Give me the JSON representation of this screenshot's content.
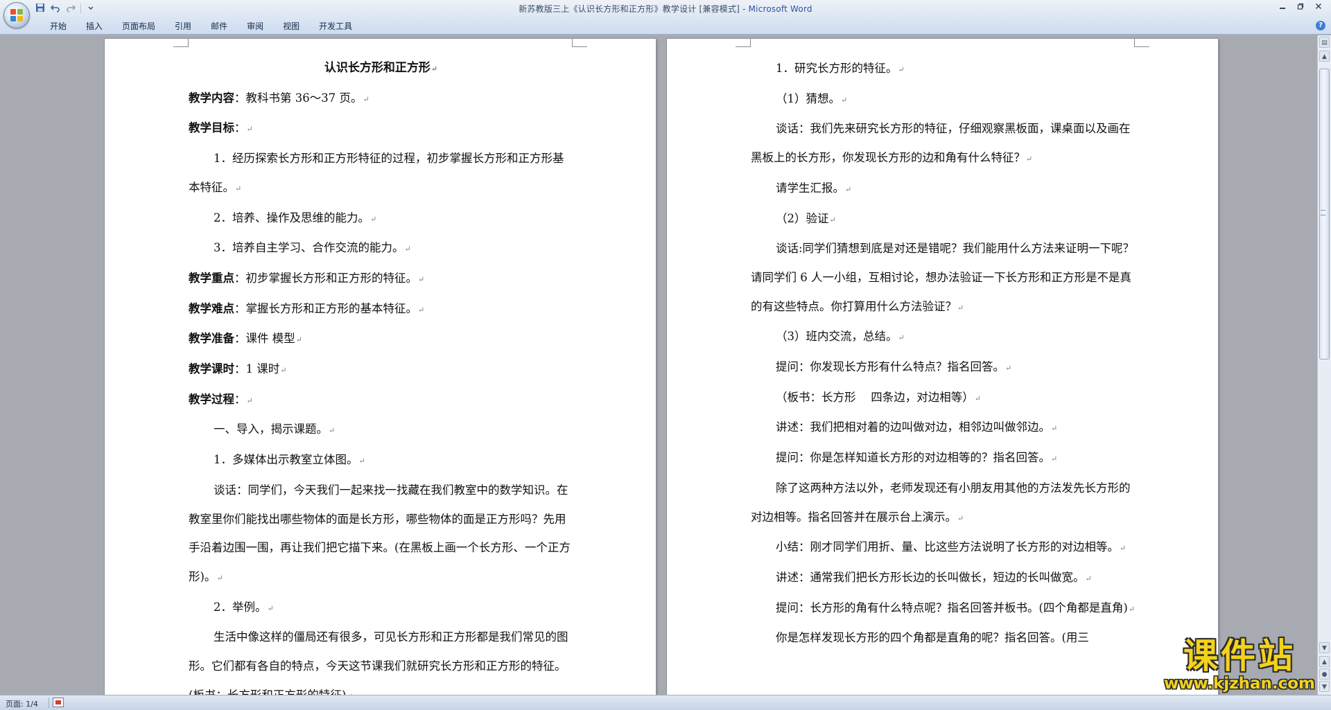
{
  "window": {
    "title": "新苏教版三上《认识长方形和正方形》教学设计 [兼容模式] - ",
    "app_name": "Microsoft Word"
  },
  "ribbon": {
    "tabs": [
      {
        "label": "开始"
      },
      {
        "label": "插入"
      },
      {
        "label": "页面布局"
      },
      {
        "label": "引用"
      },
      {
        "label": "邮件"
      },
      {
        "label": "审阅"
      },
      {
        "label": "视图"
      },
      {
        "label": "开发工具"
      }
    ]
  },
  "icons": {
    "office_button": "office-logo-icon",
    "save": "save-icon",
    "undo": "undo-icon",
    "redo": "redo-icon",
    "customize": "chevron-down-icon",
    "minimize": "minimize-icon",
    "restore": "restore-icon",
    "close": "close-icon",
    "help": "help-icon"
  },
  "colors": {
    "ribbon_bg": "#dce7f5",
    "page_bg": "#ffffff",
    "workspace_bg": "#a7abb1",
    "watermark_text": "#f3d21c"
  },
  "page_left": {
    "title": "认识长方形和正方形",
    "p1_label": "教学内容",
    "p1_text": "：教科书第 36～37 页。",
    "p2_label": "教学目标",
    "p2_text": "：",
    "p3": "1．经历探索长方形和正方形特征的过程，初步掌握长方形和正方形基本特征。",
    "p4": "2．培养、操作及思维的能力。",
    "p5": "3．培养自主学习、合作交流的能力。",
    "p6_label": "教学重点",
    "p6_text": "：初步掌握长方形和正方形的特征。",
    "p7_label": "教学难点",
    "p7_text": "：掌握长方形和正方形的基本特征。",
    "p8_label": "教学准备",
    "p8_text": "：课件 模型",
    "p9_label": "教学课时",
    "p9_text": "：1 课时",
    "p10_label": "教学过程",
    "p10_text": "：",
    "p11": "一、导入，揭示课题。",
    "p12": "1．多媒体出示教室立体图。",
    "p13": "谈话：同学们，今天我们一起来找一找藏在我们教室中的数学知识。在教室里你们能找出哪些物体的面是长方形，哪些物体的面是正方形吗？先用手沿着边围一围，再让我们把它描下来。(在黑板上画一个长方形、一个正方形)。",
    "p14": "2．举例。",
    "p15": "生活中像这样的僵局还有很多，可见长方形和正方形都是我们常见的图形。它们都有各自的特点，今天这节课我们就研究长方形和正方形的特征。(板书：长方形和正方形的特征)"
  },
  "page_right": {
    "p1": "1．研究长方形的特征。",
    "p2": "（1）猜想。",
    "p3": "谈话：我们先来研究长方形的特征，仔细观察黑板面，课桌面以及画在黑板上的长方形，你发现长方形的边和角有什么特征？",
    "p4": "请学生汇报。",
    "p5": "（2）验证",
    "p6": "谈话:同学们猜想到底是对还是错呢？我们能用什么方法来证明一下呢？请同学们 6 人一小组，互相讨论，想办法验证一下长方形和正方形是不是真的有这些特点。你打算用什么方法验证？",
    "p7": "（3）班内交流，总结。",
    "p8": "提问：你发现长方形有什么特点？指名回答。",
    "p9": "（板书：长方形　 四条边，对边相等）",
    "p10": "讲述：我们把相对着的边叫做对边，相邻边叫做邻边。",
    "p11": "提问：你是怎样知道长方形的对边相等的？指名回答。",
    "p12": "除了这两种方法以外，老师发现还有小朋友用其他的方法发先长方形的对边相等。指名回答并在展示台上演示。",
    "p13": "小结：刚才同学们用折、量、比这些方法说明了长方形的对边相等。",
    "p14": "讲述：通常我们把长方形长边的长叫做长，短边的长叫做宽。",
    "p15": "提问：长方形的角有什么特点呢？指名回答并板书。(四个角都是直角)",
    "p16": "你是怎样发现长方形的四个角都是直角的呢？指名回答。(用三"
  },
  "statusbar": {
    "page_info": "页面: 1/4"
  },
  "watermark": {
    "big": "课件站",
    "small": "www.kjzhan.com"
  }
}
